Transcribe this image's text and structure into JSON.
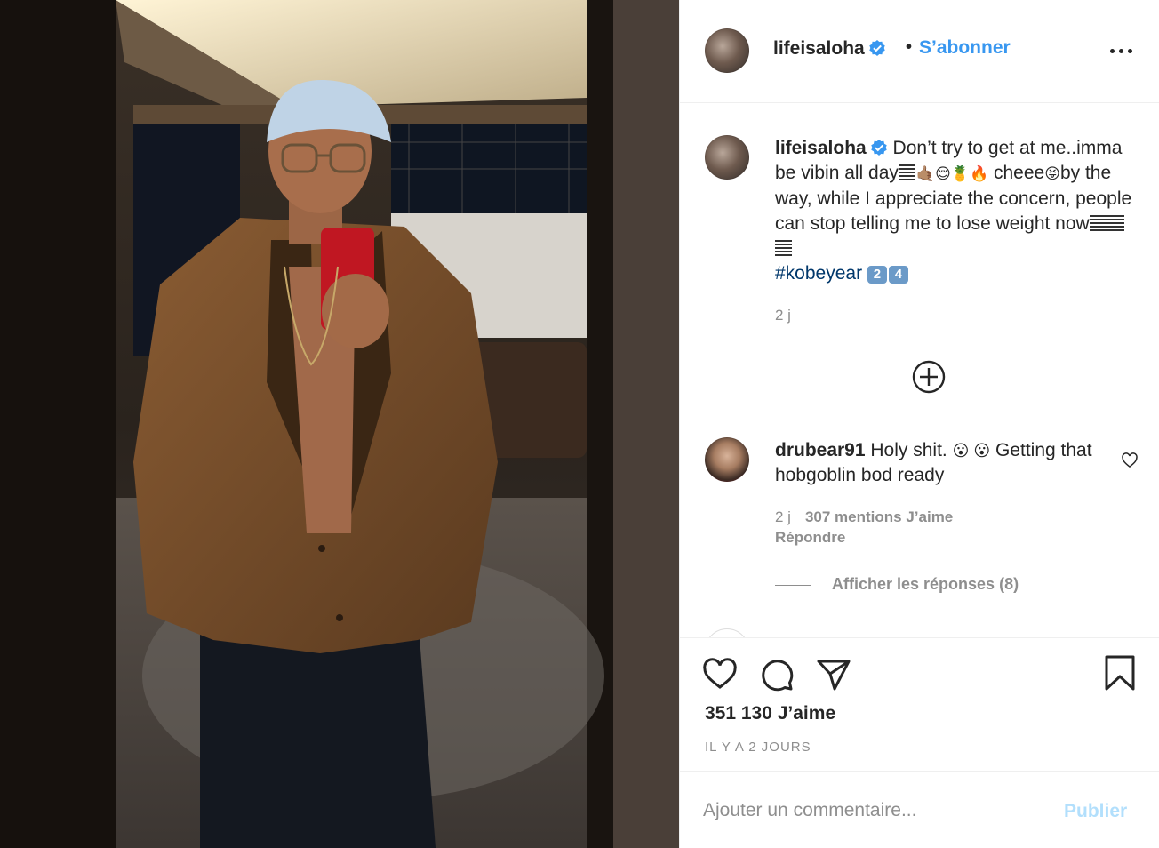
{
  "post": {
    "username": "lifeisaloha",
    "separator": "•",
    "follow_label": "S’abonner",
    "more_icon": "more-options-icon"
  },
  "caption": {
    "username": "lifeisaloha",
    "text_1": "Don’t try to get at me..imma be vibin all day",
    "emoji_1": "🤙🏽😌🍍🔥",
    "text_2": "cheee",
    "emoji_2": "😝",
    "text_3": "by the way, while I appreciate the concern, people can stop telling me to lose weight now",
    "hashtag": "#kobeyear",
    "keycap_1": "2",
    "keycap_2": "4",
    "time": "2 j"
  },
  "comment": {
    "username": "drubear91",
    "text_1": "Holy shit.",
    "emoji": "😮 😮",
    "text_2": "Getting that hobgoblin bod ready",
    "time": "2 j",
    "likes": "307 mentions J’aime",
    "reply_label": "Répondre",
    "view_replies": "Afficher les réponses (8)"
  },
  "engagement": {
    "likes_total": "351 130 J’aime",
    "posted": "IL Y A 2 JOURS"
  },
  "comment_box": {
    "placeholder": "Ajouter un commentaire...",
    "publish_label": "Publier"
  },
  "colors": {
    "accent": "#3897f0",
    "publish_disabled": "#b2dffc",
    "muted": "#8e8e8e",
    "text": "#262626"
  }
}
